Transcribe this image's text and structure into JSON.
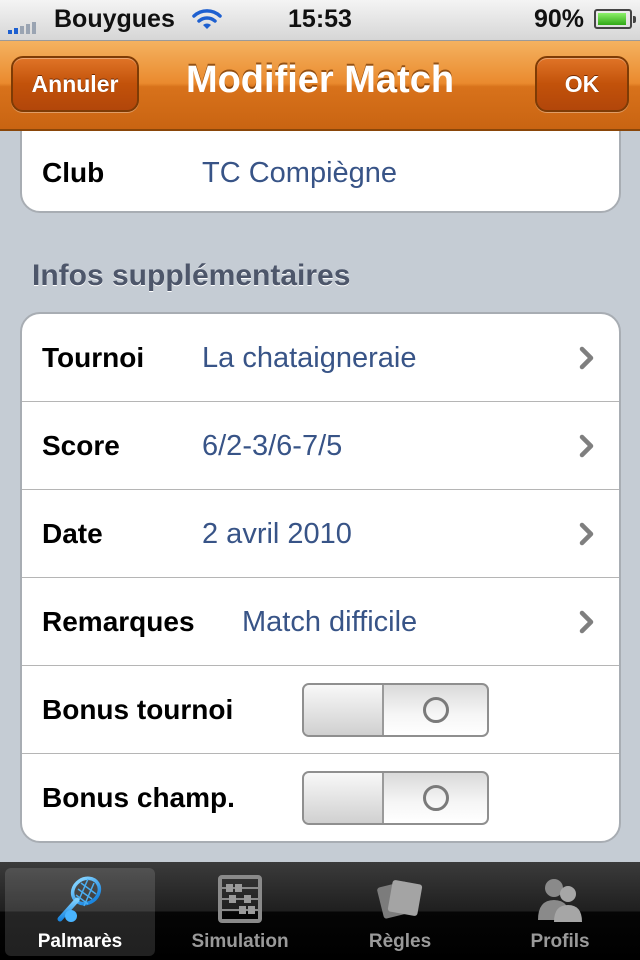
{
  "status_bar": {
    "carrier": "Bouygues",
    "time": "15:53",
    "battery_percent": "90%"
  },
  "nav": {
    "title": "Modifier Match",
    "cancel_label": "Annuler",
    "ok_label": "OK"
  },
  "club_row": {
    "label": "Club",
    "value": "TC Compiègne"
  },
  "section": {
    "header": "Infos supplémentaires"
  },
  "rows": [
    {
      "label": "Tournoi",
      "value": "La chataigneraie"
    },
    {
      "label": "Score",
      "value": "6/2-3/6-7/5"
    },
    {
      "label": "Date",
      "value": "2 avril 2010"
    },
    {
      "label": "Remarques",
      "value": "Match difficile"
    },
    {
      "label": "Bonus tournoi",
      "switch_on": false
    },
    {
      "label": "Bonus champ.",
      "switch_on": false
    }
  ],
  "tabs": [
    {
      "label": "Palmarès",
      "icon": "tennis-racket-icon",
      "active": true
    },
    {
      "label": "Simulation",
      "icon": "abacus-icon",
      "active": false
    },
    {
      "label": "Règles",
      "icon": "cards-icon",
      "active": false
    },
    {
      "label": "Profils",
      "icon": "people-icon",
      "active": false
    }
  ],
  "colors": {
    "accent": "#e07d25",
    "value_text": "#385487",
    "section_header": "#4d566a",
    "background": "#c5ccd4"
  }
}
